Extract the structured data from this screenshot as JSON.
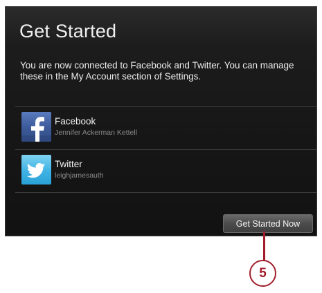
{
  "screen": {
    "title": "Get Started",
    "description": "You are now connected to Facebook and Twitter. You can manage these in the My Account section of Settings."
  },
  "accounts": [
    {
      "service": "Facebook",
      "username": "Jennifer Ackerman Kettell",
      "icon": "facebook-icon",
      "color": "#3b5998"
    },
    {
      "service": "Twitter",
      "username": "leighjamesauth",
      "icon": "twitter-icon",
      "color": "#3fb3e4"
    }
  ],
  "actions": {
    "get_started_label": "Get Started Now"
  },
  "callout": {
    "number": "5",
    "color": "#a11d2b"
  }
}
